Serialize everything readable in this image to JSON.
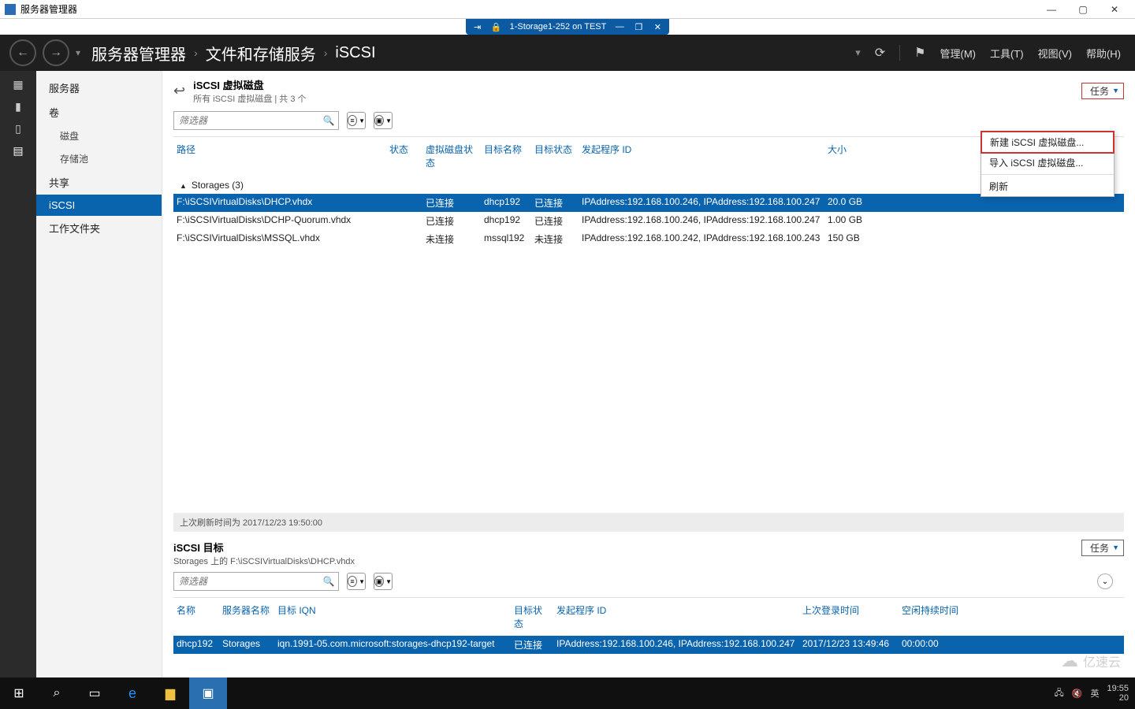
{
  "outer_window": {
    "title": "服务器管理器"
  },
  "vm_bar": {
    "title": "1-Storage1-252 on TEST"
  },
  "header": {
    "crumb1": "服务器管理器",
    "crumb2": "文件和存储服务",
    "crumb3": "iSCSI",
    "menu_manage": "管理(M)",
    "menu_tools": "工具(T)",
    "menu_view": "视图(V)",
    "menu_help": "帮助(H)"
  },
  "sidebar": {
    "items": [
      "服务器",
      "卷",
      "磁盘",
      "存储池",
      "共享",
      "iSCSI",
      "工作文件夹"
    ],
    "selected_index": 5
  },
  "section1": {
    "title": "iSCSI 虚拟磁盘",
    "subtitle": "所有 iSCSI 虚拟磁盘 | 共 3 个",
    "tasks_label": "任务",
    "filter_placeholder": "筛选器",
    "columns": {
      "path": "路径",
      "status": "状态",
      "vdisk": "虚拟磁盘状态",
      "tname": "目标名称",
      "tstat": "目标状态",
      "init": "发起程序 ID",
      "size": "大小"
    },
    "group_label": "Storages (3)",
    "rows": [
      {
        "path": "F:\\iSCSIVirtualDisks\\DHCP.vhdx",
        "status": "",
        "vdisk": "已连接",
        "tname": "dhcp192",
        "tstat": "已连接",
        "init": "IPAddress:192.168.100.246, IPAddress:192.168.100.247",
        "size": "20.0 GB",
        "selected": true
      },
      {
        "path": "F:\\iSCSIVirtualDisks\\DCHP-Quorum.vhdx",
        "status": "",
        "vdisk": "已连接",
        "tname": "dhcp192",
        "tstat": "已连接",
        "init": "IPAddress:192.168.100.246, IPAddress:192.168.100.247",
        "size": "1.00 GB",
        "selected": false
      },
      {
        "path": "F:\\iSCSIVirtualDisks\\MSSQL.vhdx",
        "status": "",
        "vdisk": "未连接",
        "tname": "mssql192",
        "tstat": "未连接",
        "init": "IPAddress:192.168.100.242, IPAddress:192.168.100.243",
        "size": "150 GB",
        "selected": false
      }
    ],
    "status_line": "上次刷新时间为 2017/12/23 19:50:00"
  },
  "tasks_menu": {
    "item_new": "新建 iSCSI 虚拟磁盘...",
    "item_import": "导入 iSCSI 虚拟磁盘...",
    "item_refresh": "刷新"
  },
  "section2": {
    "title": "iSCSI 目标",
    "subtitle": "Storages 上的 F:\\iSCSIVirtualDisks\\DHCP.vhdx",
    "tasks_label": "任务",
    "filter_placeholder": "筛选器",
    "columns": {
      "name": "名称",
      "server": "服务器名称",
      "iqn": "目标 IQN",
      "tstat": "目标状态",
      "init": "发起程序 ID",
      "login": "上次登录时间",
      "idle": "空闲持续时间"
    },
    "rows": [
      {
        "name": "dhcp192",
        "server": "Storages",
        "iqn": "iqn.1991-05.com.microsoft:storages-dhcp192-target",
        "tstat": "已连接",
        "init": "IPAddress:192.168.100.246, IPAddress:192.168.100.247",
        "login": "2017/12/23 13:49:46",
        "idle": "00:00:00",
        "selected": true
      }
    ]
  },
  "taskbar": {
    "ime": "英",
    "clock_time": "19:55",
    "clock_date": "20"
  },
  "watermark": "亿速云"
}
